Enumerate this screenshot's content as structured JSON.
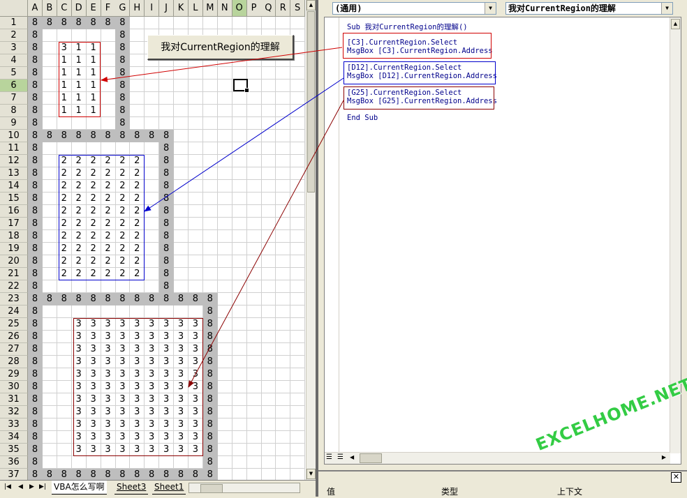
{
  "excel": {
    "columns": [
      "A",
      "B",
      "C",
      "D",
      "E",
      "F",
      "G",
      "H",
      "I",
      "J",
      "K",
      "L",
      "M",
      "N",
      "O",
      "P",
      "Q",
      "R",
      "S"
    ],
    "selected_column": "O",
    "rows": [
      "1",
      "2",
      "3",
      "4",
      "5",
      "6",
      "7",
      "8",
      "9",
      "10",
      "11",
      "12",
      "13",
      "14",
      "15",
      "16",
      "17",
      "18",
      "19",
      "20",
      "21",
      "22",
      "23",
      "24",
      "25",
      "26",
      "27",
      "28",
      "29",
      "30",
      "31",
      "32",
      "33",
      "34",
      "35",
      "36",
      "37"
    ],
    "selected_row": "6",
    "border_value": "8",
    "region1_value": "1",
    "region1_corner_value": "3",
    "region2_value": "2",
    "region3_value": "3",
    "sheet_button_label": "我对CurrentRegion的理解",
    "sheet_tabs": [
      "VBA怎么写啊",
      "Sheet3",
      "Sheet1"
    ]
  },
  "vbe": {
    "object_combo": "(通用)",
    "procedure_combo": "我对CurrentRegion的理解",
    "code_lines": {
      "sub_line": "Sub 我对CurrentRegion的理解()",
      "c3_select": "[C3].CurrentRegion.Select",
      "c3_msg": "MsgBox [C3].CurrentRegion.Address",
      "d12_select": "[D12].CurrentRegion.Select",
      "d12_msg": "MsgBox [D12].CurrentRegion.Address",
      "g25_select": "[G25].CurrentRegion.Select",
      "g25_msg": "MsgBox [G25].CurrentRegion.Address",
      "end_sub": "End Sub"
    },
    "watch_pane": {
      "col_value": "值",
      "col_type": "类型",
      "col_context": "上下文"
    },
    "watermark": "EXCELHOME.NET"
  },
  "colors": {
    "box1": "#d00000",
    "box2": "#0000cc",
    "box3": "#8b0000",
    "gray_border": "#bebebe",
    "selected_header": "#b8d49c",
    "watermark": "#33cc44"
  }
}
